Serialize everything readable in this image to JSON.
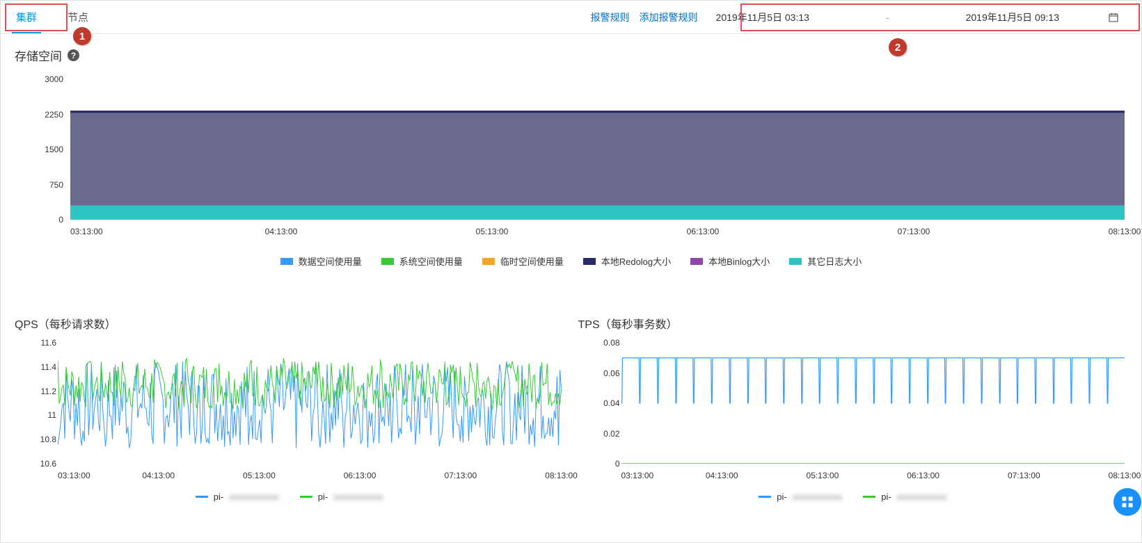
{
  "tabs": {
    "cluster": "集群",
    "node": "节点"
  },
  "links": {
    "alarm_rules": "报警规则",
    "add_alarm_rule": "添加报警规则"
  },
  "date_range": {
    "from": "2019年11月5日 03:13",
    "to": "2019年11月5日 09:13",
    "dash": "-"
  },
  "storage": {
    "title": "存储空间"
  },
  "qps": {
    "title": "QPS（每秒请求数）"
  },
  "tps": {
    "title": "TPS（每秒事务数）"
  },
  "annotations": {
    "b1": "1",
    "b2": "2"
  },
  "legend_pi_a": "pi-",
  "legend_pi_b": "pi-",
  "colors": {
    "blue": "#3399ff",
    "green": "#33cc33",
    "orange": "#f5a623",
    "navy": "#2a2a6d",
    "purple": "#8e44ad",
    "teal": "#2dc7c3",
    "slate": "#6a6a8c"
  },
  "chart_data": [
    {
      "name": "storage",
      "type": "area",
      "title": "存储空间",
      "ylabel": "",
      "ylim": [
        0,
        3000
      ],
      "yticks": [
        0,
        750,
        1500,
        2250,
        3000
      ],
      "x": [
        "03:13:00",
        "04:13:00",
        "05:13:00",
        "06:13:00",
        "07:13:00",
        "08:13:00"
      ],
      "series": [
        {
          "name": "数据空间使用量",
          "color": "#3399ff",
          "values_flat": 0
        },
        {
          "name": "系统空间使用量",
          "color": "#33cc33",
          "values_flat": 0
        },
        {
          "name": "临时空间使用量",
          "color": "#f5a623",
          "values_flat": 0
        },
        {
          "name": "本地Redolog大小",
          "color": "#2a2a6d",
          "values_flat": 2300
        },
        {
          "name": "本地Binlog大小",
          "color": "#8e44ad",
          "values_flat": 0
        },
        {
          "name": "其它日志大小",
          "color": "#2dc7c3",
          "values_flat": 300
        }
      ],
      "stacked_total": 2300,
      "stacked_teal_top": 300
    },
    {
      "name": "qps",
      "type": "line",
      "title": "QPS（每秒请求数）",
      "ylim": [
        10.6,
        11.6
      ],
      "yticks": [
        10.6,
        10.8,
        11,
        11.2,
        11.4,
        11.6
      ],
      "x": [
        "03:13:00",
        "04:13:00",
        "05:13:00",
        "06:13:00",
        "07:13:00",
        "08:13:00"
      ],
      "series": [
        {
          "name": "pi-",
          "color": "#3399ff",
          "baseline": 11.1,
          "noise_amp": 0.35,
          "spike_down": 10.75
        },
        {
          "name": "pi-",
          "color": "#33cc33",
          "baseline": 11.25,
          "noise_amp": 0.2,
          "spike_up": 11.45
        }
      ]
    },
    {
      "name": "tps",
      "type": "line",
      "title": "TPS（每秒事务数）",
      "ylim": [
        0,
        0.08
      ],
      "yticks": [
        0,
        0.02,
        0.04,
        0.06,
        0.08
      ],
      "x": [
        "03:13:00",
        "04:13:00",
        "05:13:00",
        "06:13:00",
        "07:13:00",
        "08:13:00"
      ],
      "series": [
        {
          "name": "pi-",
          "color": "#3399ff",
          "baseline": 0.07,
          "dip_to": 0.04,
          "dips": 28
        },
        {
          "name": "pi-",
          "color": "#33cc33",
          "baseline": 0.0,
          "flat": true
        }
      ]
    }
  ]
}
